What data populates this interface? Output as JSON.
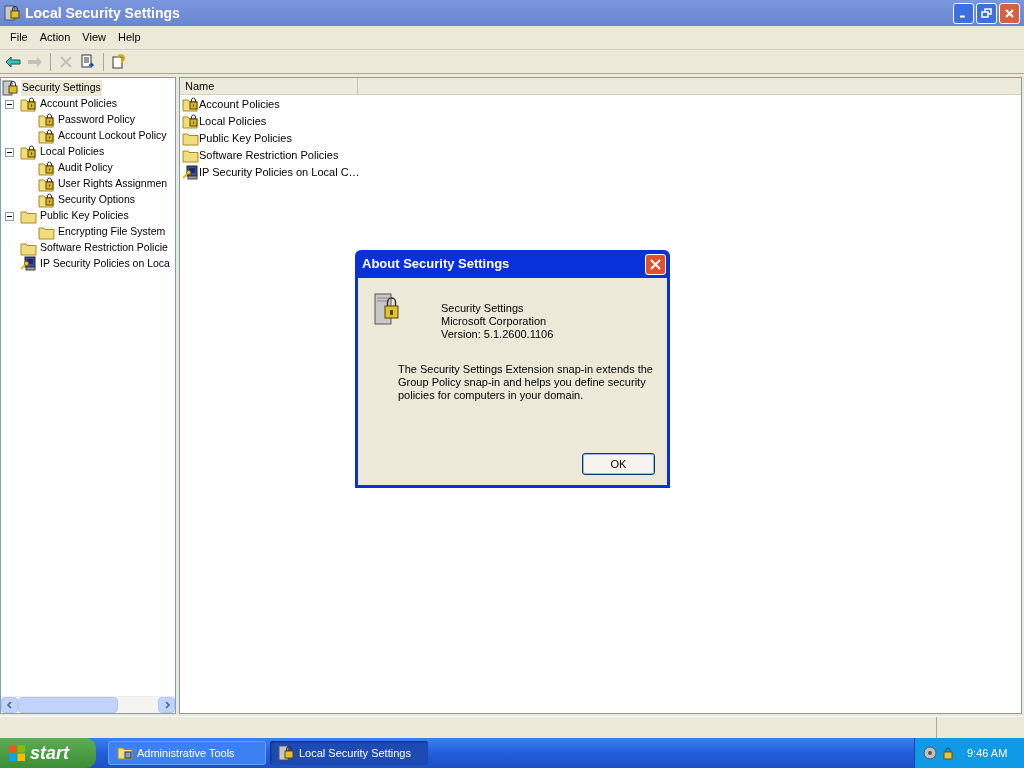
{
  "window": {
    "title": "Local Security Settings"
  },
  "menu": [
    "File",
    "Action",
    "View",
    "Help"
  ],
  "toolbar": [
    {
      "kind": "back",
      "disabled": false
    },
    {
      "kind": "forward",
      "disabled": true
    },
    {
      "kind": "delete",
      "disabled": true
    },
    {
      "kind": "export",
      "disabled": false
    },
    {
      "kind": "help",
      "disabled": false
    }
  ],
  "tree": {
    "label": "Security Settings",
    "kind": "root",
    "selected": true,
    "children": [
      {
        "label": "Account Policies",
        "kind": "locked-folder",
        "expanded": true,
        "children": [
          {
            "label": "Password Policy",
            "kind": "locked-folder"
          },
          {
            "label": "Account Lockout Policy",
            "kind": "locked-folder"
          }
        ]
      },
      {
        "label": "Local Policies",
        "kind": "locked-folder",
        "expanded": true,
        "children": [
          {
            "label": "Audit Policy",
            "kind": "locked-folder"
          },
          {
            "label": "User Rights Assignmen",
            "kind": "locked-folder"
          },
          {
            "label": "Security Options",
            "kind": "locked-folder"
          }
        ]
      },
      {
        "label": "Public Key Policies",
        "kind": "folder",
        "expanded": true,
        "children": [
          {
            "label": "Encrypting File System",
            "kind": "folder"
          }
        ]
      },
      {
        "label": "Software Restriction Policie",
        "kind": "folder"
      },
      {
        "label": "IP Security Policies on Loca",
        "kind": "ip-security"
      }
    ]
  },
  "list": {
    "columns": [
      "Name"
    ],
    "rows": [
      {
        "label": "Account Policies",
        "kind": "locked-folder"
      },
      {
        "label": "Local Policies",
        "kind": "locked-folder"
      },
      {
        "label": "Public Key Policies",
        "kind": "folder"
      },
      {
        "label": "Software Restriction Policies",
        "kind": "folder"
      },
      {
        "label": "IP Security Policies on Local C…",
        "kind": "ip-security"
      }
    ]
  },
  "dialog": {
    "title": "About Security Settings",
    "product": "Security Settings",
    "company": "Microsoft Corporation",
    "version": "Version: 5.1.2600.1106",
    "description": "The Security Settings Extension snap-in extends the Group Policy snap-in and helps you define security policies for computers in your domain.",
    "button": "OK"
  },
  "taskbar": {
    "start": "start",
    "tasks": [
      {
        "label": "Administrative Tools",
        "selected": false
      },
      {
        "label": "Local Security Settings",
        "selected": true
      }
    ],
    "clock": "9:46 AM"
  }
}
